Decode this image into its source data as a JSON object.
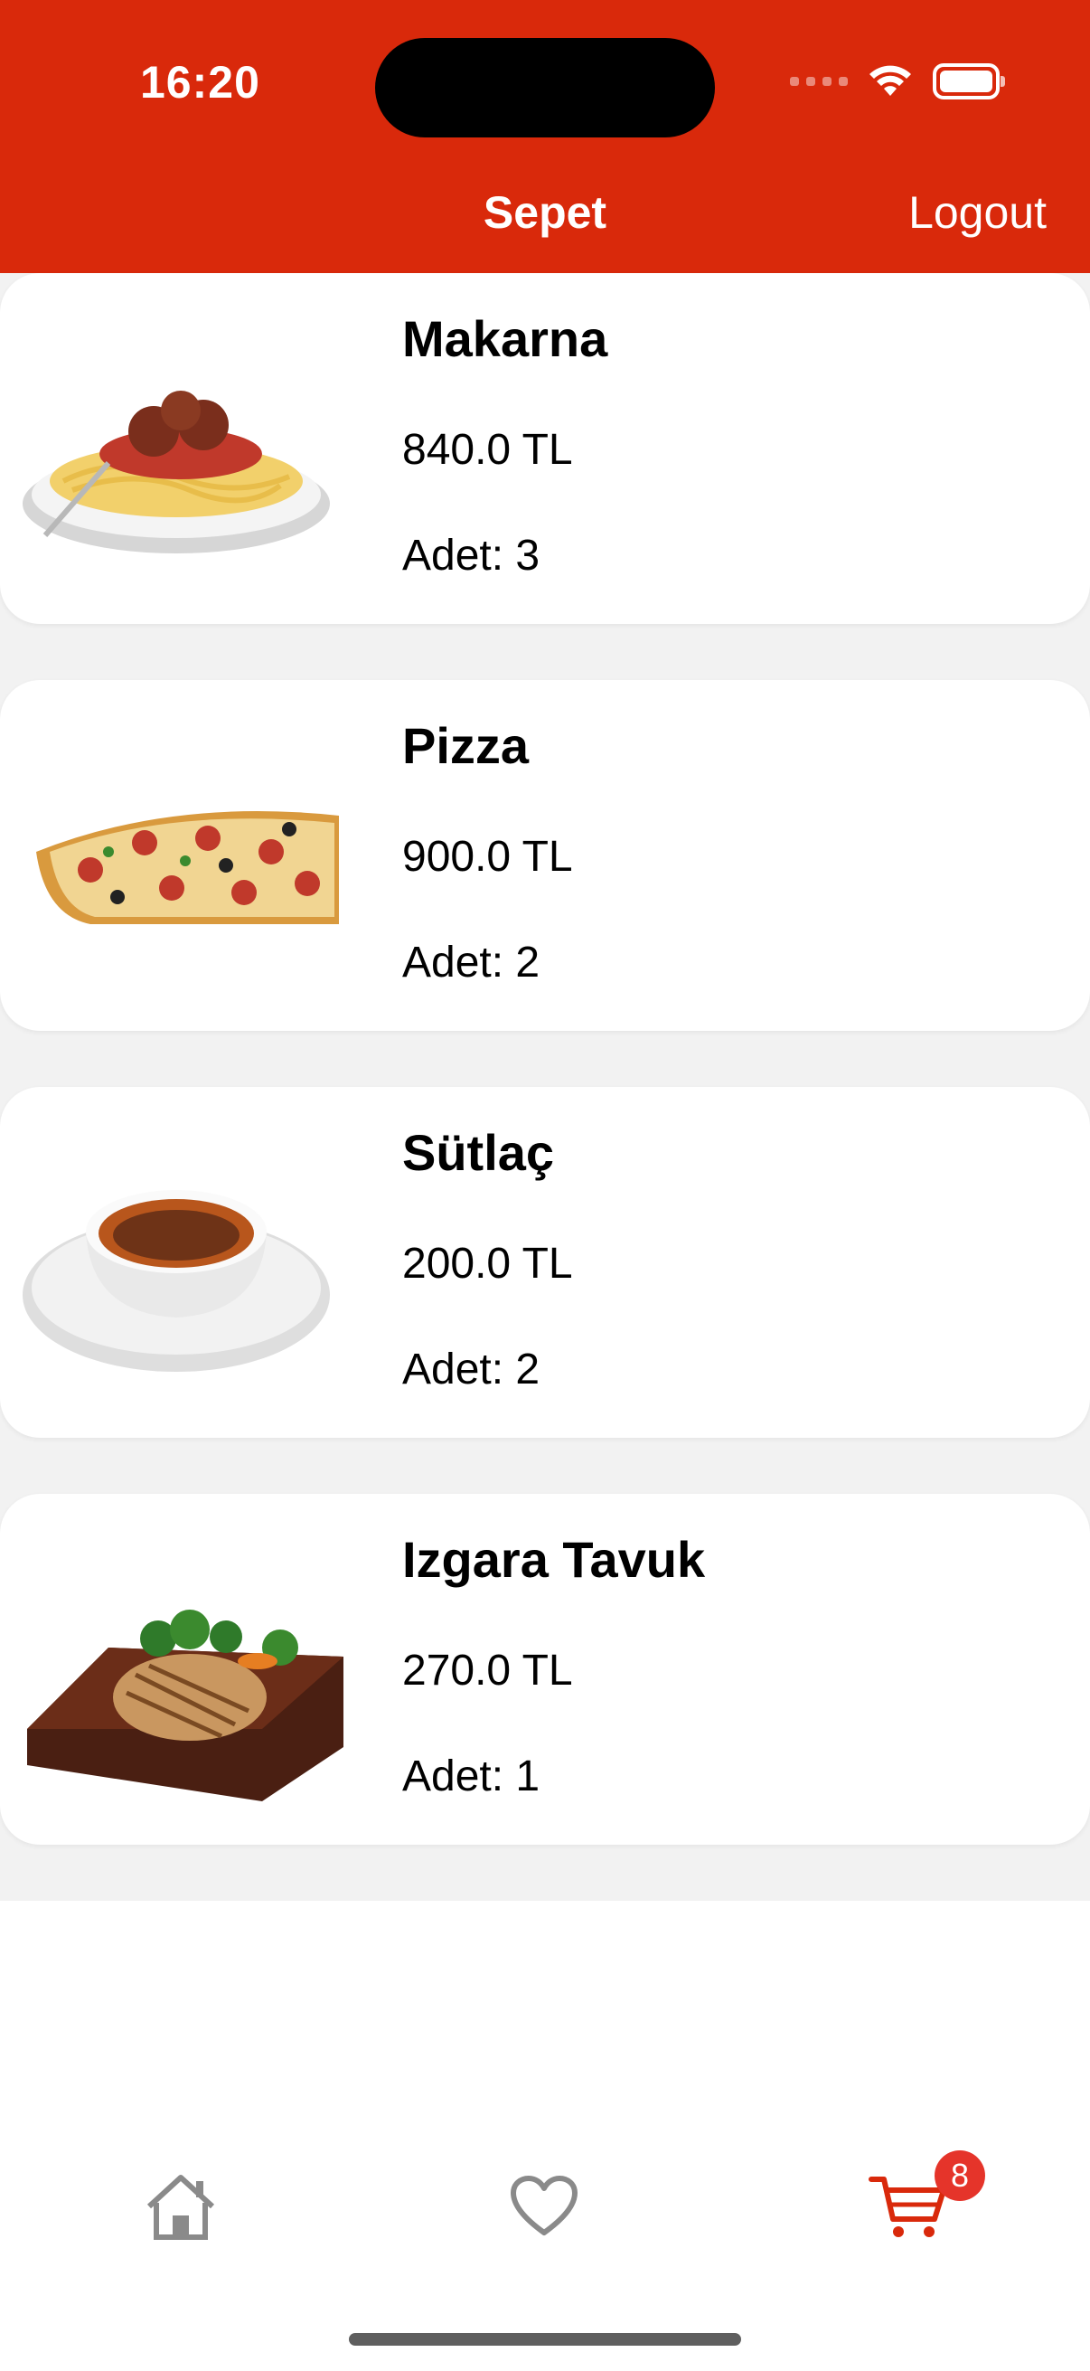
{
  "status_bar": {
    "time": "16:20"
  },
  "nav": {
    "title": "Sepet",
    "logout_label": "Logout"
  },
  "cart_items": [
    {
      "name": "Makarna",
      "price": "840.0 TL",
      "quantity": "Adet: 3",
      "image": "spaghetti-image"
    },
    {
      "name": "Pizza",
      "price": "900.0 TL",
      "quantity": "Adet: 2",
      "image": "pizza-image"
    },
    {
      "name": "Sütlaç",
      "price": "200.0 TL",
      "quantity": "Adet: 2",
      "image": "rice-pudding-image"
    },
    {
      "name": "Izgara Tavuk",
      "price": "270.0 TL",
      "quantity": "Adet: 1",
      "image": "grilled-chicken-image"
    }
  ],
  "tab_bar": {
    "tabs": [
      {
        "icon": "home-icon",
        "active": false
      },
      {
        "icon": "heart-icon",
        "active": false
      },
      {
        "icon": "cart-icon",
        "active": true
      }
    ],
    "cart_badge": "8"
  },
  "colors": {
    "accent": "#d9290b",
    "inactive_icon": "#8a8a8a",
    "badge": "#e5342a"
  }
}
